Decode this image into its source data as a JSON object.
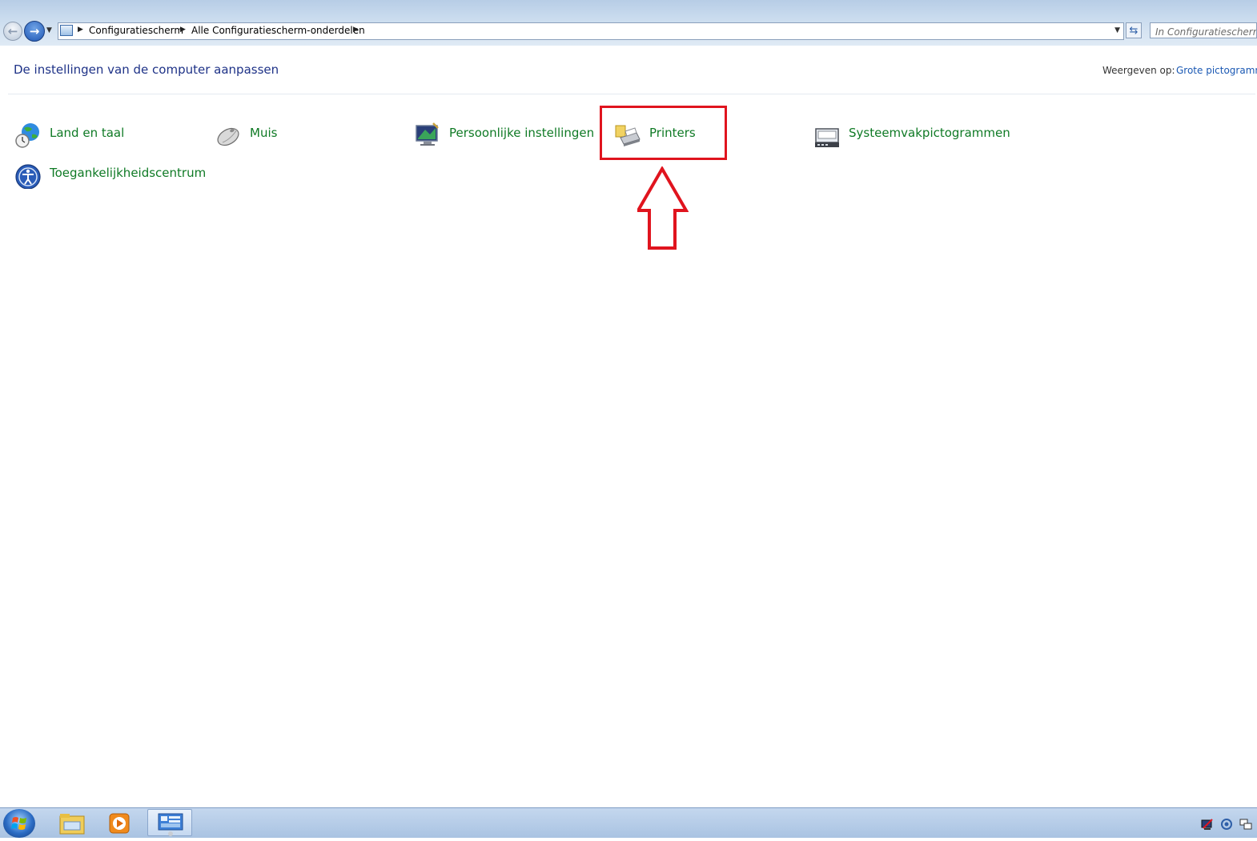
{
  "addressbar": {
    "breadcrumbs": [
      "Configuratiescherm",
      "Alle Configuratiescherm-onderdelen"
    ],
    "search_placeholder": "In Configuratiescherm zoeken"
  },
  "header": {
    "title": "De instellingen van de computer aanpassen",
    "view_label": "Weergeven op:",
    "view_value": "Grote pictogrammen"
  },
  "items": [
    {
      "label": "Land en taal",
      "icon": "globe-clock-icon"
    },
    {
      "label": "Muis",
      "icon": "mouse-icon"
    },
    {
      "label": "Persoonlijke instellingen",
      "icon": "monitor-brush-icon"
    },
    {
      "label": "Printers",
      "icon": "printer-icon"
    },
    {
      "label": "Systeemvakpictogrammen",
      "icon": "notification-area-icon"
    },
    {
      "label": "Toegankelijkheidscentrum",
      "icon": "accessibility-icon"
    }
  ],
  "annotation": {
    "highlight_color": "#e0141e",
    "highlighted_item": "Printers"
  },
  "colors": {
    "item_link": "#0f7a25",
    "title": "#1e3287",
    "view_link": "#1a58b3"
  },
  "taskbar": {
    "buttons": [
      "windows-explorer-icon",
      "media-player-icon",
      "control-panel-icon"
    ],
    "tray": [
      "network-icon",
      "volume-icon",
      "show-desktop-icon"
    ]
  }
}
